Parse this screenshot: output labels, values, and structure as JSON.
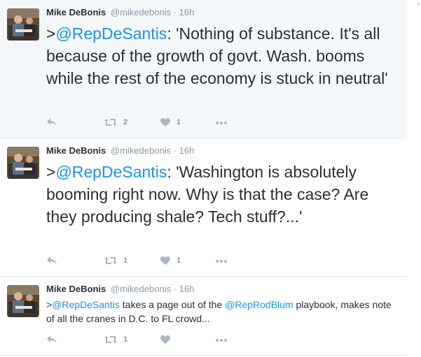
{
  "tweets": [
    {
      "author_name": "Mike DeBonis",
      "handle": "@mikedebonis",
      "separator": "·",
      "time": "16h",
      "text_prefix": ">",
      "mention": "@RepDeSantis",
      "text_body": ": 'Nothing of substance. It's all because of the growth of govt. Wash. booms while the rest of the economy is stuck in neutral'",
      "retweet_count": "2",
      "like_count": "1"
    },
    {
      "author_name": "Mike DeBonis",
      "handle": "@mikedebonis",
      "separator": "·",
      "time": "16h",
      "text_prefix": ">",
      "mention": "@RepDeSantis",
      "text_body": ": 'Washington is absolutely booming right now. Why is that the case? Are they producing shale? Tech stuff?...'",
      "retweet_count": "1",
      "like_count": "1"
    },
    {
      "author_name": "Mike DeBonis",
      "handle": "@mikedebonis",
      "separator": "·",
      "time": "16h",
      "text_prefix": ">",
      "mention": "@RepDeSantis",
      "text_mid": " takes a page out of the ",
      "mention2": "@RepRodBlum",
      "text_body": " playbook, makes note of all the cranes in D.C. to FL crowd...",
      "retweet_count": "1",
      "like_count": ""
    }
  ],
  "icons": {
    "reply": "reply-icon",
    "retweet": "retweet-icon",
    "like": "heart-icon",
    "more": "more-dots-icon"
  },
  "colors": {
    "link": "#1b95e0",
    "text": "#292f33",
    "meta": "#8899a6",
    "action_icon": "#aab8c2",
    "highlight_background": "#f5f8fa"
  }
}
